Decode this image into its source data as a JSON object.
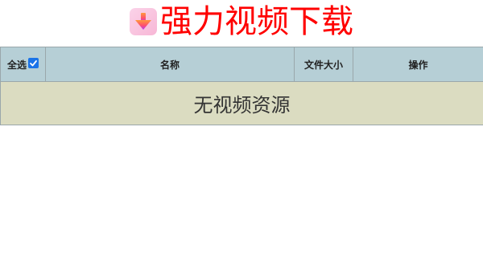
{
  "header": {
    "title": "强力视频下载",
    "logo_icon": "download-arrow-icon"
  },
  "table": {
    "select_all_label": "全选",
    "select_all_checked": true,
    "columns": {
      "name": "名称",
      "size": "文件大小",
      "action": "操作"
    },
    "empty_message": "无视频资源"
  },
  "colors": {
    "title": "#ff0000",
    "header_bg": "#b6cfd6",
    "empty_row_bg": "#dbdcc1",
    "checkbox": "#1a73e8"
  }
}
